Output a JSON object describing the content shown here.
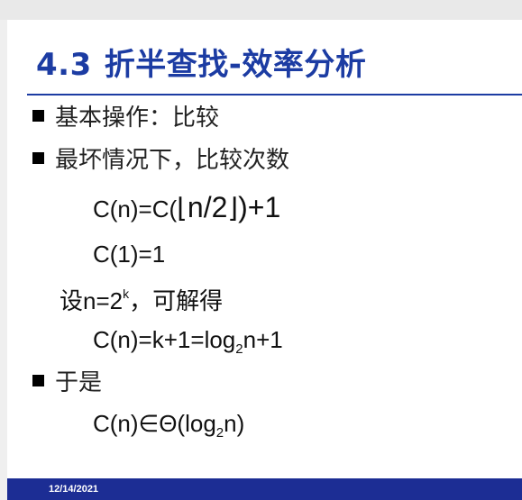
{
  "slide": {
    "title_num": "4.3",
    "title_text": "折半查找-效率分析",
    "bullets": [
      "基本操作：比较",
      "最坏情况下，比较次数",
      "于是"
    ],
    "eq1_prefix": "C(n)=C(",
    "eq1_floor_left": "⌊",
    "eq1_inner": "n/2",
    "eq1_floor_right": "⌋",
    "eq1_suffix": ")+1",
    "eq2": "C(1)=1",
    "setup_prefix": "设n=2",
    "setup_sup": "k",
    "setup_suffix": "，可解得",
    "eq3_prefix": "C(n)=k+1=log",
    "eq3_sub": "2",
    "eq3_suffix": "n+1",
    "eq4_prefix": "C(n)∈Θ(log",
    "eq4_sub": "2",
    "eq4_suffix": "n)",
    "footer_date": "12/14/2021"
  },
  "colors": {
    "title": "#1c3ca3",
    "footer_bar": "#1c2d94"
  }
}
